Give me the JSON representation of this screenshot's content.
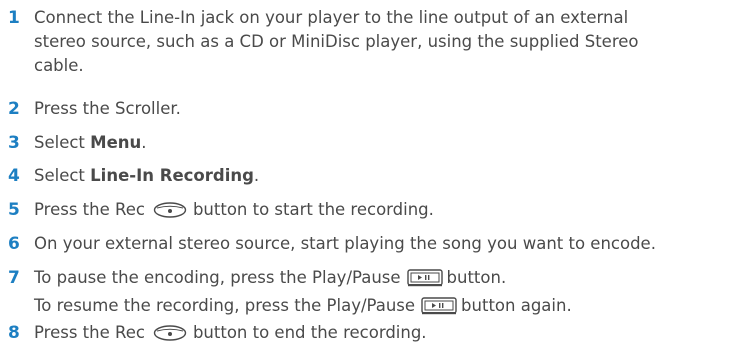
{
  "steps": [
    {
      "num": "1",
      "lines": [
        "Connect the Line-In jack on your player to the line output of an external",
        "stereo source, such as a CD or MiniDisc player, using the supplied Stereo",
        "cable."
      ]
    },
    {
      "num": "2",
      "text": "Press the Scroller."
    },
    {
      "num": "3",
      "pre": "Select ",
      "bold": "Menu",
      "post": "."
    },
    {
      "num": "4",
      "pre": "Select ",
      "bold": "Line-In Recording",
      "post": "."
    },
    {
      "num": "5",
      "pre": "Press the Rec",
      "post": "button to start the recording."
    },
    {
      "num": "6",
      "text": "On your external stereo source, start playing the song you want to encode."
    },
    {
      "num": "7",
      "line1_pre": "To pause the encoding, press the Play/Pause",
      "line1_post": "button.",
      "line2_pre": "To resume the recording, press the Play/Pause",
      "line2_post": "button again."
    },
    {
      "num": "8",
      "pre": "Press the Rec",
      "post": "button to end the recording."
    }
  ],
  "colors": {
    "number": "#1d7fc2",
    "text": "#4a4a4a"
  },
  "icons": {
    "rec": "rec-button-icon",
    "play_pause": "play-pause-button-icon"
  }
}
